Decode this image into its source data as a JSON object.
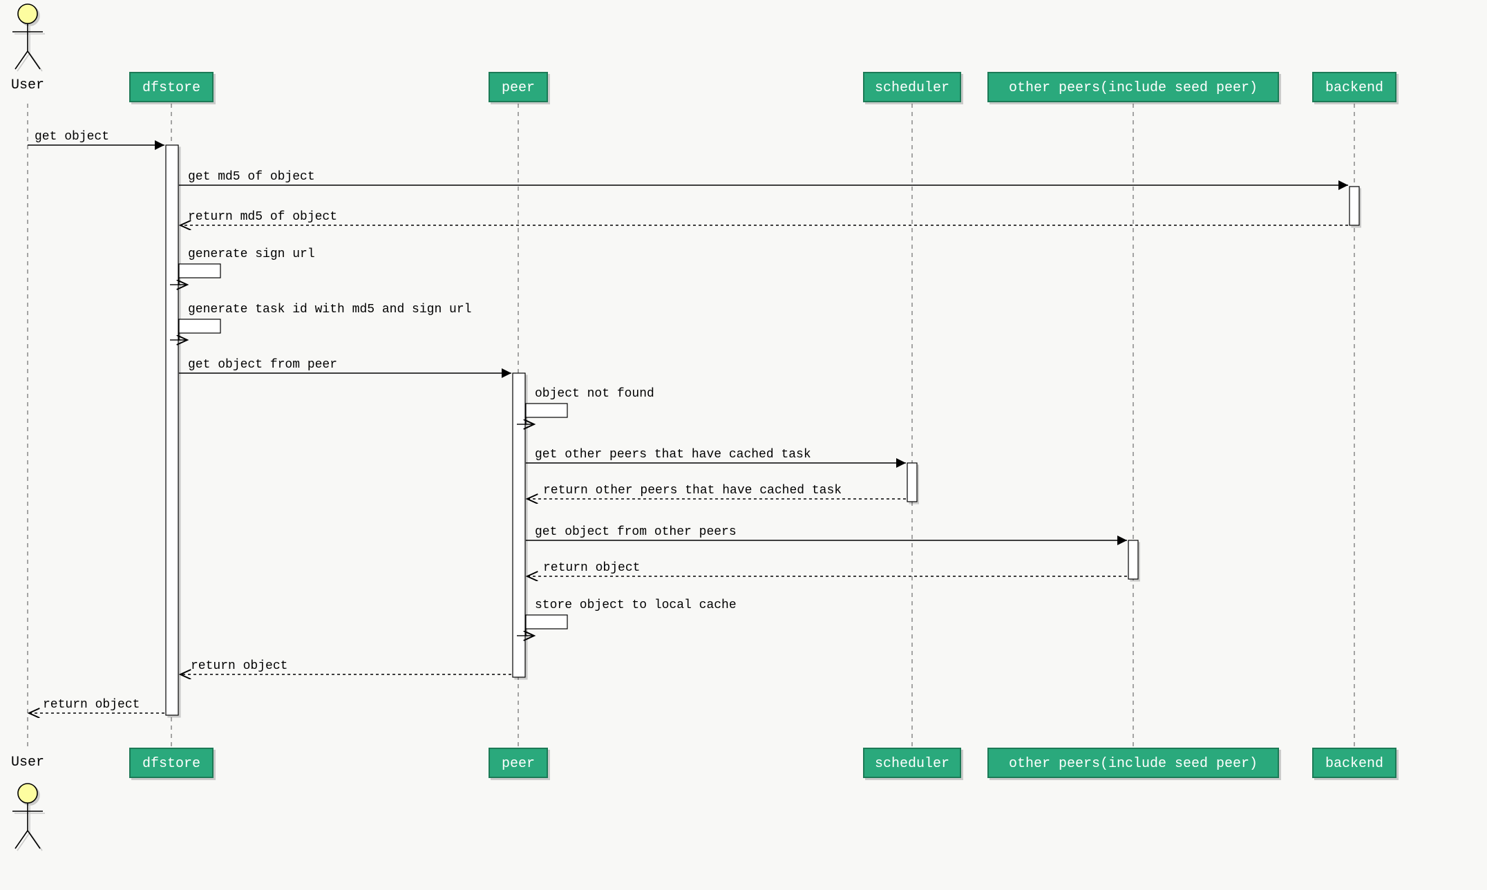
{
  "actor": {
    "label": "User"
  },
  "participants": {
    "dfstore": {
      "label": "dfstore"
    },
    "peer": {
      "label": "peer"
    },
    "scheduler": {
      "label": "scheduler"
    },
    "otherpeers": {
      "label": "other peers(include seed peer)"
    },
    "backend": {
      "label": "backend"
    }
  },
  "messages": {
    "m1": "get object",
    "m2": "get md5 of object",
    "m3": "return md5 of object",
    "m4": "generate sign url",
    "m5": "generate task id with md5 and sign url",
    "m6": "get object from peer",
    "m7": "object not found",
    "m8": "get other peers that have cached task",
    "m9": "return other peers that have cached task",
    "m10": "get object from other peers",
    "m11": "return object",
    "m12": "store object to local cache",
    "m13": "return object",
    "m14": "return object"
  },
  "colors": {
    "participant": "#2ca97b",
    "participantBorder": "#1a7a56",
    "background": "#f8f8f6"
  },
  "chart_data": {
    "type": "sequence-diagram",
    "actors": [
      "User"
    ],
    "participants": [
      "dfstore",
      "peer",
      "scheduler",
      "other peers(include seed peer)",
      "backend"
    ],
    "interactions": [
      {
        "from": "User",
        "to": "dfstore",
        "label": "get object",
        "kind": "sync"
      },
      {
        "from": "dfstore",
        "to": "backend",
        "label": "get md5 of object",
        "kind": "sync"
      },
      {
        "from": "backend",
        "to": "dfstore",
        "label": "return md5 of object",
        "kind": "return"
      },
      {
        "from": "dfstore",
        "to": "dfstore",
        "label": "generate sign url",
        "kind": "self"
      },
      {
        "from": "dfstore",
        "to": "dfstore",
        "label": "generate task id with md5 and sign url",
        "kind": "self"
      },
      {
        "from": "dfstore",
        "to": "peer",
        "label": "get object from peer",
        "kind": "sync"
      },
      {
        "from": "peer",
        "to": "peer",
        "label": "object not found",
        "kind": "self"
      },
      {
        "from": "peer",
        "to": "scheduler",
        "label": "get other peers that have cached task",
        "kind": "sync"
      },
      {
        "from": "scheduler",
        "to": "peer",
        "label": "return other peers that have cached task",
        "kind": "return"
      },
      {
        "from": "peer",
        "to": "other peers(include seed peer)",
        "label": "get object from other peers",
        "kind": "sync"
      },
      {
        "from": "other peers(include seed peer)",
        "to": "peer",
        "label": "return object",
        "kind": "return"
      },
      {
        "from": "peer",
        "to": "peer",
        "label": "store object to local cache",
        "kind": "self"
      },
      {
        "from": "peer",
        "to": "dfstore",
        "label": "return object",
        "kind": "return"
      },
      {
        "from": "dfstore",
        "to": "User",
        "label": "return object",
        "kind": "return"
      }
    ]
  }
}
